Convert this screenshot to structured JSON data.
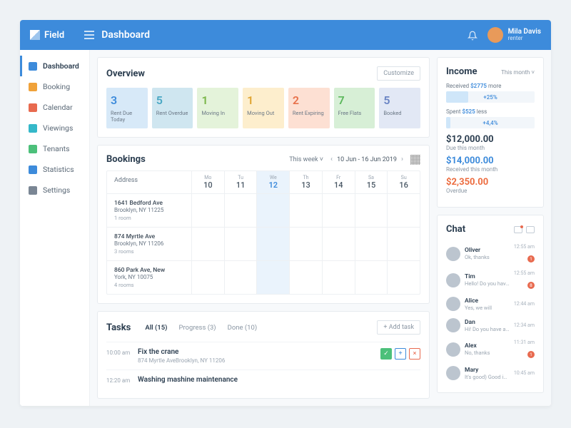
{
  "brand": "Field",
  "page_title": "Dashboard",
  "user": {
    "name": "Mila Davis",
    "role": "renter"
  },
  "nav": [
    {
      "label": "Dashboard",
      "icon": "grid",
      "color": "#3d8bdb",
      "active": true
    },
    {
      "label": "Booking",
      "icon": "home",
      "color": "#f0a23a"
    },
    {
      "label": "Calendar",
      "icon": "calendar",
      "color": "#e86a4f"
    },
    {
      "label": "Viewings",
      "icon": "eye",
      "color": "#35b8c9"
    },
    {
      "label": "Tenants",
      "icon": "users",
      "color": "#4cc07a"
    },
    {
      "label": "Statistics",
      "icon": "stats",
      "color": "#3d8bdb"
    },
    {
      "label": "Settings",
      "icon": "gear",
      "color": "#7a8694"
    }
  ],
  "overview": {
    "title": "Overview",
    "customize": "Customize",
    "stats": [
      {
        "num": "3",
        "label": "Rent Due Today",
        "bg": "#d7e9f8",
        "fg": "#3d8bdb"
      },
      {
        "num": "5",
        "label": "Rent Overdue",
        "bg": "#cfe6f0",
        "fg": "#4aa8c4"
      },
      {
        "num": "1",
        "label": "Moving In",
        "bg": "#e4f3da",
        "fg": "#7ab648"
      },
      {
        "num": "1",
        "label": "Moving Out",
        "bg": "#fdeecd",
        "fg": "#e0a533"
      },
      {
        "num": "2",
        "label": "Rent Expiring",
        "bg": "#fde0d3",
        "fg": "#e8714b"
      },
      {
        "num": "7",
        "label": "Free Flats",
        "bg": "#d7efd6",
        "fg": "#5cb85c"
      },
      {
        "num": "5",
        "label": "Booked",
        "bg": "#e2e8f5",
        "fg": "#6a84c4"
      }
    ]
  },
  "bookings": {
    "title": "Bookings",
    "week_label": "This week",
    "range": "10 Jun - 16 Jun 2019",
    "addr_header": "Address",
    "days": [
      {
        "dow": "Mo",
        "num": "10"
      },
      {
        "dow": "Tu",
        "num": "11"
      },
      {
        "dow": "We",
        "num": "12",
        "active": true
      },
      {
        "dow": "Th",
        "num": "13"
      },
      {
        "dow": "Fr",
        "num": "14"
      },
      {
        "dow": "Sa",
        "num": "15"
      },
      {
        "dow": "Su",
        "num": "16"
      }
    ],
    "rows": [
      {
        "l1": "1641 Bedford Ave",
        "l2": "Brooklyn, NY 11225",
        "l3": "1 room"
      },
      {
        "l1": "874 Myrtle Ave",
        "l2": "Brooklyn, NY 11206",
        "l3": "3 rooms"
      },
      {
        "l1": "860 Park Ave, New",
        "l2": "York, NY 10075",
        "l3": "4 rooms"
      }
    ]
  },
  "tasks": {
    "title": "Tasks",
    "tabs": [
      {
        "label": "All (15)",
        "active": true
      },
      {
        "label": "Progress (3)"
      },
      {
        "label": "Done (10)"
      }
    ],
    "add": "+ Add task",
    "items": [
      {
        "time": "10:00 am",
        "title": "Fix the crane",
        "sub": "874 Myrtle AveBrooklyn, NY 11206",
        "actions": true
      },
      {
        "time": "12:20 am",
        "title": "Washing mashine maintenance",
        "sub": ""
      }
    ]
  },
  "income": {
    "title": "Income",
    "period": "This month",
    "received": {
      "prefix": "Received ",
      "amt": "$2775",
      "suffix": " more",
      "bar": "+25%",
      "fill": 25
    },
    "spent": {
      "prefix": "Spent ",
      "amt": "$525",
      "suffix": " less",
      "bar": "+4,4%",
      "fill": 5
    },
    "figures": [
      {
        "amount": "$12,000.00",
        "label": "Due this month",
        "cls": "c-dark"
      },
      {
        "amount": "$14,000.00",
        "label": "Received this month",
        "cls": "c-blue"
      },
      {
        "amount": "$2,350.00",
        "label": "Overdue",
        "cls": "c-orange"
      }
    ]
  },
  "chat": {
    "title": "Chat",
    "items": [
      {
        "name": "Oliver",
        "msg": "Ok, thanks",
        "time": "12:55 am",
        "badge": "1"
      },
      {
        "name": "Tim",
        "msg": "Hello! Do you have…",
        "time": "12:55 am",
        "badge": "8"
      },
      {
        "name": "Alice",
        "msg": "Yes, we will",
        "time": "12:44 am"
      },
      {
        "name": "Dan",
        "msg": "Hi! Do you have an…",
        "time": "12:34 am"
      },
      {
        "name": "Alex",
        "msg": "No, thanks",
        "time": "11:31 am",
        "badge": "1"
      },
      {
        "name": "Mary",
        "msg": "It's good) Good ideas…",
        "time": "10:45 am"
      }
    ]
  }
}
